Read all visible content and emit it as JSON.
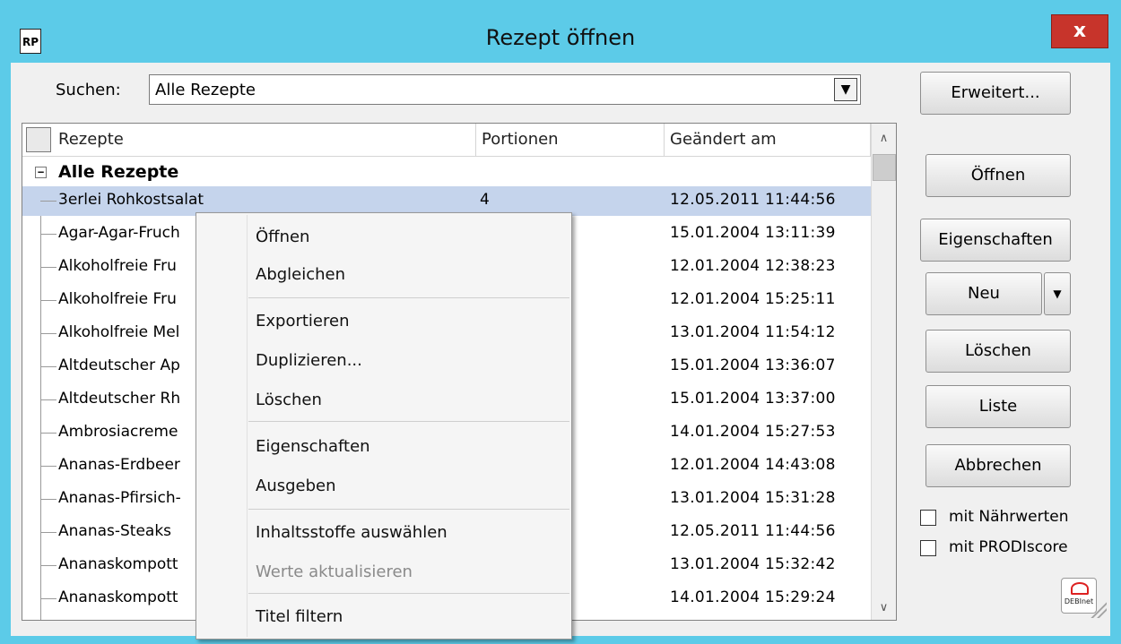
{
  "window": {
    "title": "Rezept öffnen",
    "icon_text": "RP",
    "close_label": "x"
  },
  "search": {
    "label": "Suchen:",
    "value": "Alle Rezepte"
  },
  "buttons": {
    "advanced": "Erweitert...",
    "open": "Öffnen",
    "properties": "Eigenschaften",
    "new": "Neu",
    "delete": "Löschen",
    "list": "Liste",
    "cancel": "Abbrechen"
  },
  "list": {
    "columns": [
      "Rezepte",
      "Portionen",
      "Geändert am"
    ],
    "group": "Alle Rezepte",
    "rows": [
      {
        "name": "3erlei Rohkostsalat",
        "portions": "4",
        "changed": "12.05.2011 11:44:56",
        "selected": true
      },
      {
        "name": "Agar-Agar-Fruch",
        "portions": "",
        "changed": "15.01.2004 13:11:39"
      },
      {
        "name": "Alkoholfreie Fru",
        "portions": "",
        "changed": "12.01.2004 12:38:23"
      },
      {
        "name": "Alkoholfreie Fru",
        "portions": "",
        "changed": "12.01.2004 15:25:11"
      },
      {
        "name": "Alkoholfreie Mel",
        "portions": "",
        "changed": "13.01.2004 11:54:12"
      },
      {
        "name": "Altdeutscher Ap",
        "portions": "",
        "changed": "15.01.2004 13:36:07"
      },
      {
        "name": "Altdeutscher Rh",
        "portions": "",
        "changed": "15.01.2004 13:37:00"
      },
      {
        "name": "Ambrosiacreme",
        "portions": "",
        "changed": "14.01.2004 15:27:53"
      },
      {
        "name": "Ananas-Erdbeer",
        "portions": "",
        "changed": "12.01.2004 14:43:08"
      },
      {
        "name": "Ananas-Pfirsich-",
        "portions": "",
        "changed": "13.01.2004 15:31:28"
      },
      {
        "name": "Ananas-Steaks",
        "portions": "",
        "changed": "12.05.2011 11:44:56"
      },
      {
        "name": "Ananaskompott",
        "portions": "",
        "changed": "13.01.2004 15:32:42"
      },
      {
        "name": "Ananaskompott",
        "portions": "",
        "changed": "14.01.2004 15:29:24"
      }
    ]
  },
  "context_menu": {
    "items": [
      {
        "label": "Öffnen"
      },
      {
        "label": "Abgleichen"
      },
      {
        "label": "Exportieren"
      },
      {
        "label": "Duplizieren..."
      },
      {
        "label": "Löschen"
      },
      {
        "label": "Eigenschaften"
      },
      {
        "label": "Ausgeben"
      },
      {
        "label": "Inhaltsstoffe auswählen"
      },
      {
        "label": "Werte aktualisieren",
        "disabled": true
      },
      {
        "label": "Titel filtern"
      }
    ]
  },
  "options": {
    "nutrients": {
      "label": "mit Nährwerten",
      "checked": false
    },
    "prodiscore": {
      "label": "mit PRODIscore",
      "checked": false
    }
  },
  "logo_text": "DEBInet",
  "colors": {
    "titlebar": "#5ccbe8",
    "close": "#c7342b",
    "selection": "#c5d4ec"
  }
}
